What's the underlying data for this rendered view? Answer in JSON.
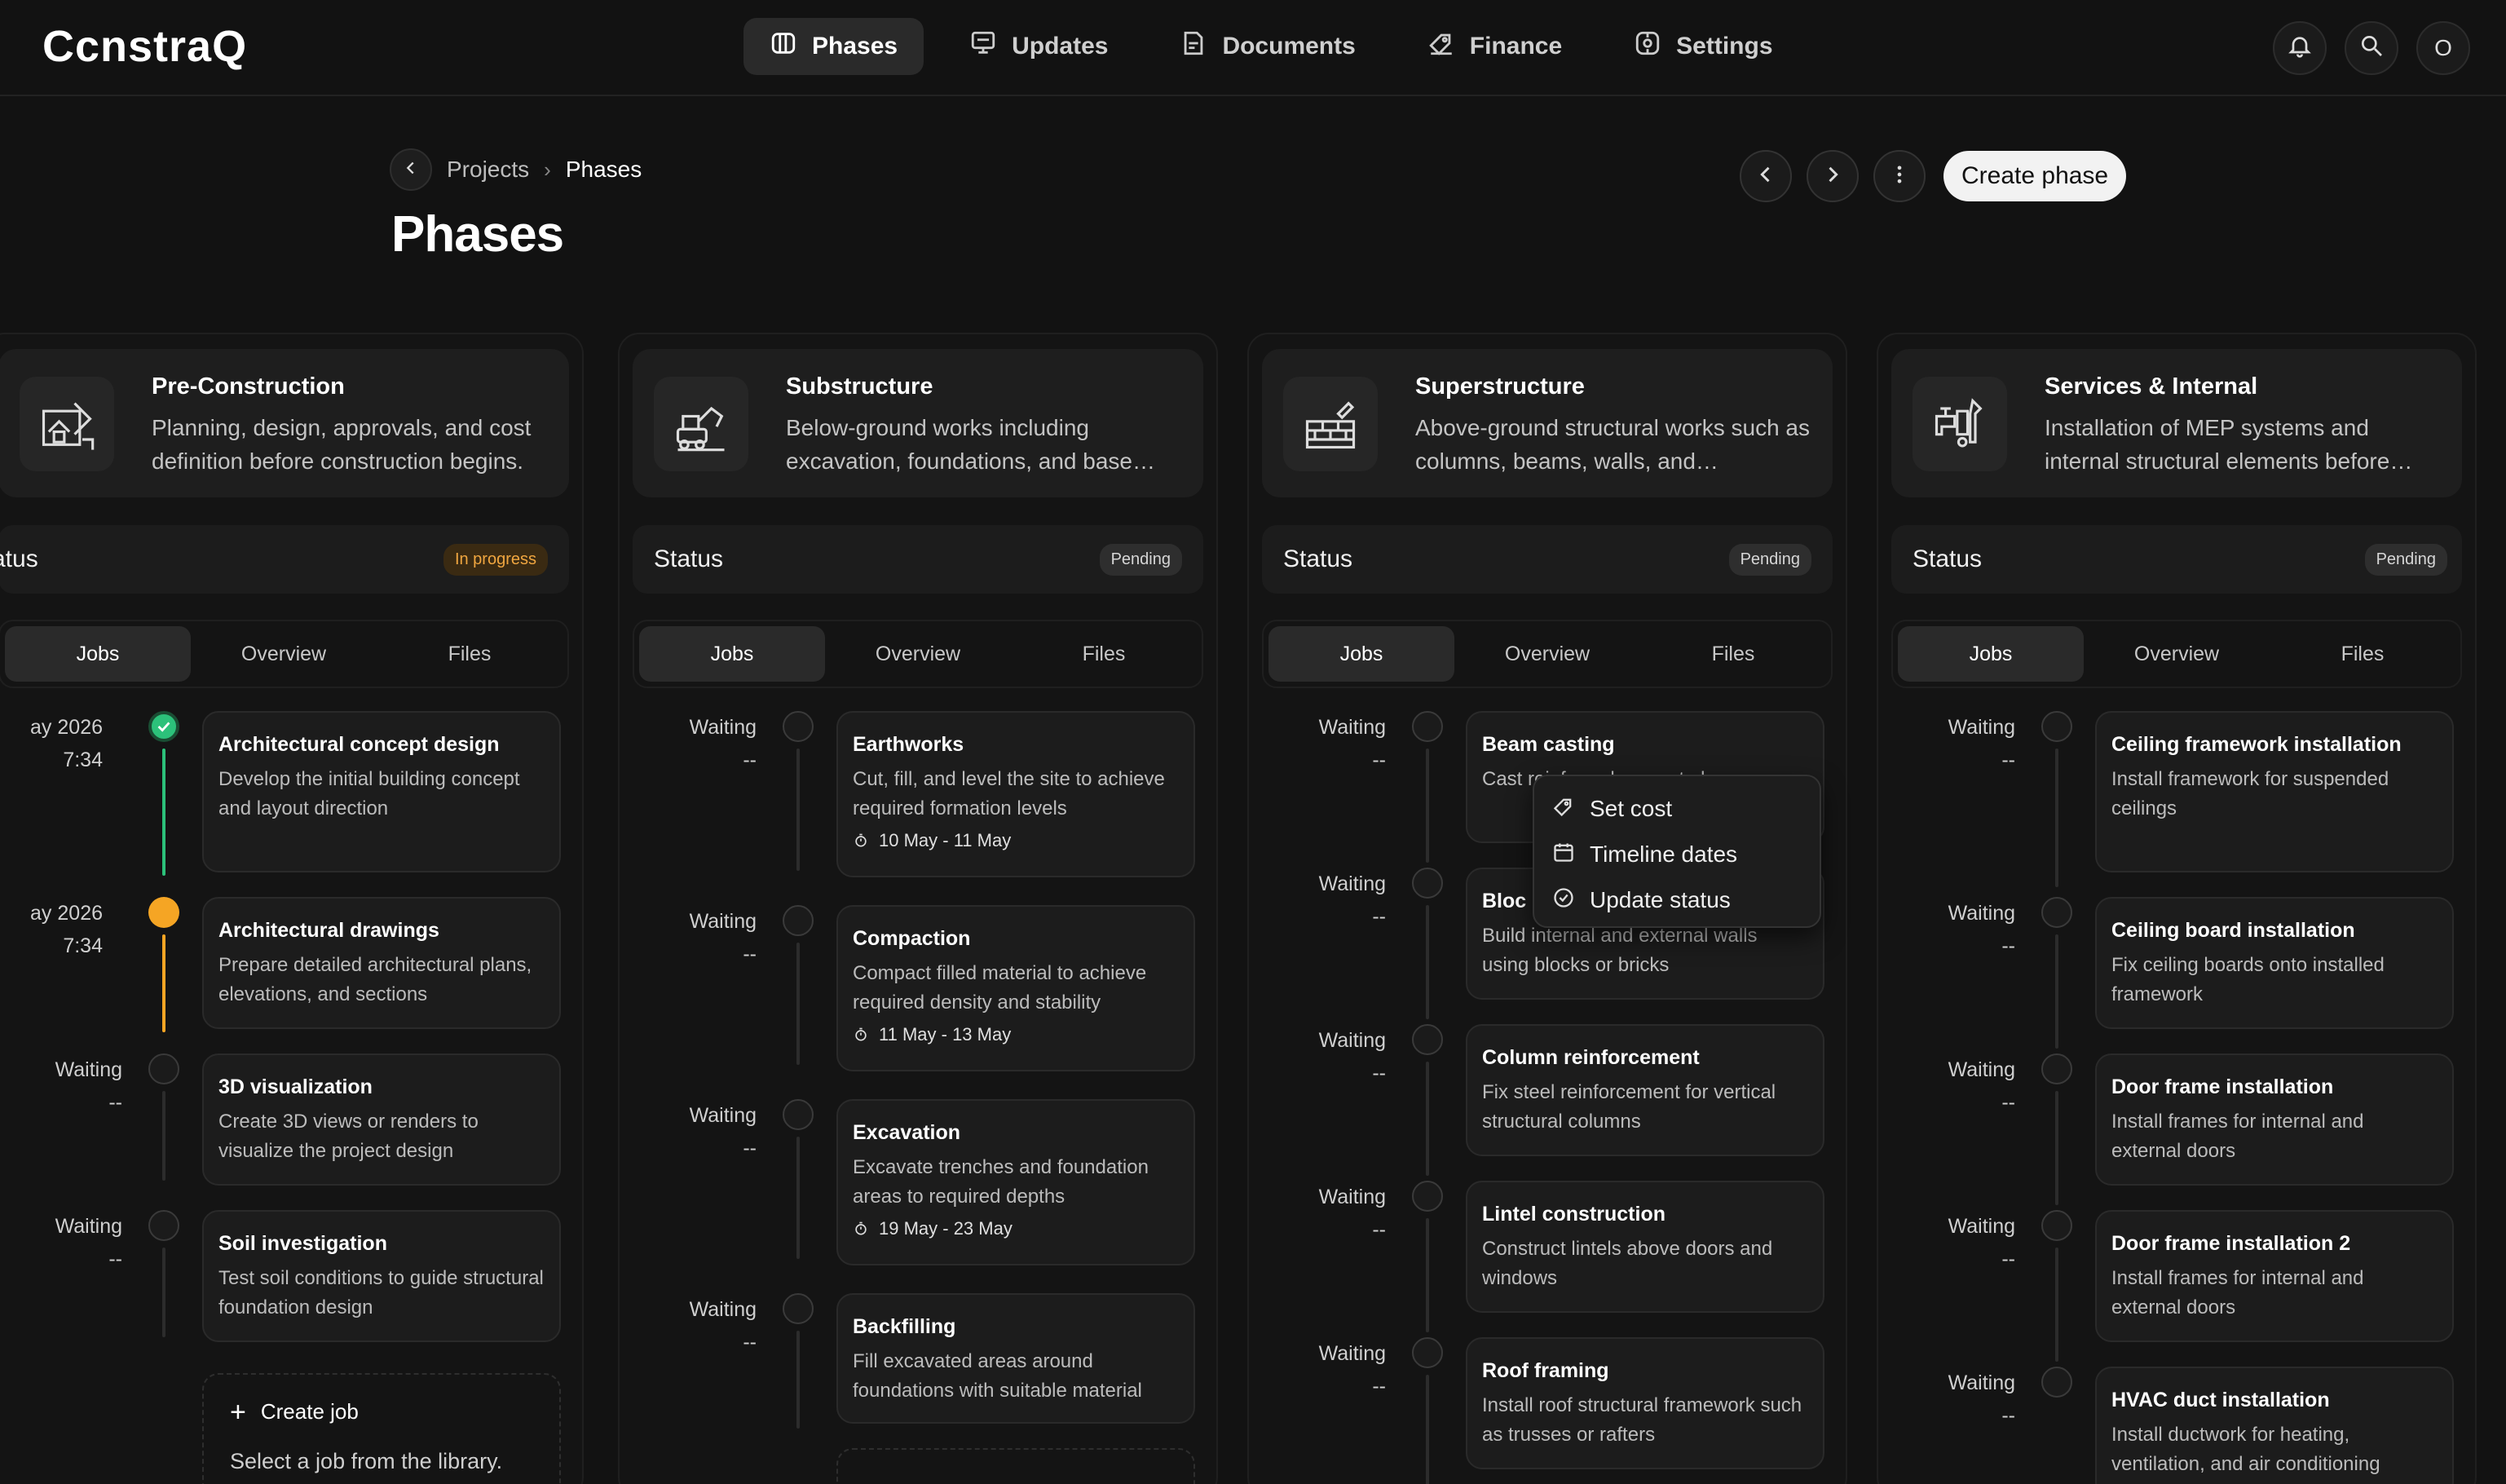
{
  "app": {
    "logo": "CcnstraQ"
  },
  "nav": {
    "tabs": [
      {
        "label": "Phases",
        "icon": "phases-icon",
        "active": true
      },
      {
        "label": "Updates",
        "icon": "updates-icon",
        "active": false
      },
      {
        "label": "Documents",
        "icon": "documents-icon",
        "active": false
      },
      {
        "label": "Finance",
        "icon": "finance-icon",
        "active": false
      },
      {
        "label": "Settings",
        "icon": "settings-icon",
        "active": false
      }
    ],
    "avatar_initial": "O"
  },
  "breadcrumb": {
    "parent": "Projects",
    "current": "Phases"
  },
  "page": {
    "title": "Phases",
    "create_button": "Create phase"
  },
  "status_label": "Status",
  "tabs": [
    "Jobs",
    "Overview",
    "Files"
  ],
  "columns": [
    {
      "title": "Pre-Construction",
      "description": "Planning, design, approvals, and cost definition before construction begins.",
      "status_label": "atus",
      "status": "In progress",
      "jobs": [
        {
          "time_top": "ay 2026",
          "time_bottom": "7:34",
          "title": "Architectural concept design",
          "description": "Develop the initial building concept and layout direction",
          "dates": ""
        },
        {
          "time_top": "ay 2026",
          "time_bottom": "7:34",
          "title": "Architectural drawings",
          "description": "Prepare detailed architectural plans, elevations, and sections",
          "dates": ""
        },
        {
          "time_top": "Waiting",
          "time_bottom": "--",
          "title": "3D visualization",
          "description": "Create 3D views or renders to visualize the project design",
          "dates": ""
        },
        {
          "time_top": "Waiting",
          "time_bottom": "--",
          "title": "Soil investigation",
          "description": "Test soil conditions to guide structural foundation design",
          "dates": ""
        }
      ],
      "create_job": {
        "title": "Create job",
        "subtitle": "Select a job from the library."
      }
    },
    {
      "title": "Substructure",
      "description": "Below-ground works including excavation, foundations, and base…",
      "status_label": "Status",
      "status": "Pending",
      "jobs": [
        {
          "time_top": "Waiting",
          "time_bottom": "--",
          "title": "Earthworks",
          "description": "Cut, fill, and level the site to achieve required formation levels",
          "dates": "10 May - 11 May"
        },
        {
          "time_top": "Waiting",
          "time_bottom": "--",
          "title": "Compaction",
          "description": "Compact filled material to achieve required density and stability",
          "dates": "11 May - 13 May"
        },
        {
          "time_top": "Waiting",
          "time_bottom": "--",
          "title": "Excavation",
          "description": "Excavate trenches and foundation areas to required depths",
          "dates": "19 May - 23 May"
        },
        {
          "time_top": "Waiting",
          "time_bottom": "--",
          "title": "Backfilling",
          "description": "Fill excavated areas around foundations with suitable material",
          "dates": ""
        }
      ]
    },
    {
      "title": "Superstructure",
      "description": "Above-ground structural works such as columns, beams, walls, and…",
      "status_label": "Status",
      "status": "Pending",
      "jobs": [
        {
          "time_top": "Waiting",
          "time_bottom": "--",
          "title": "Beam casting",
          "description": "Cast reinforced concrete beams",
          "dates": ""
        },
        {
          "time_top": "Waiting",
          "time_bottom": "--",
          "title": "Bloc",
          "description": "Build internal and external walls using blocks or bricks",
          "dates": ""
        },
        {
          "time_top": "Waiting",
          "time_bottom": "--",
          "title": "Column reinforcement",
          "description": "Fix steel reinforcement for vertical structural columns",
          "dates": ""
        },
        {
          "time_top": "Waiting",
          "time_bottom": "--",
          "title": "Lintel construction",
          "description": "Construct lintels above doors and windows",
          "dates": ""
        },
        {
          "time_top": "Waiting",
          "time_bottom": "--",
          "title": "Roof framing",
          "description": "Install roof structural framework such as trusses or rafters",
          "dates": ""
        }
      ]
    },
    {
      "title": "Services & Internal",
      "description": "Installation of MEP systems and internal structural elements before…",
      "status_label": "Status",
      "status": "Pending",
      "jobs": [
        {
          "time_top": "Waiting",
          "time_bottom": "--",
          "title": "Ceiling framework installation",
          "description": "Install framework for suspended ceilings",
          "dates": ""
        },
        {
          "time_top": "Waiting",
          "time_bottom": "--",
          "title": "Ceiling board installation",
          "description": "Fix ceiling boards onto installed framework",
          "dates": ""
        },
        {
          "time_top": "Waiting",
          "time_bottom": "--",
          "title": "Door frame installation",
          "description": "Install frames for internal and external doors",
          "dates": ""
        },
        {
          "time_top": "Waiting",
          "time_bottom": "--",
          "title": "Door frame installation 2",
          "description": "Install frames for internal and external doors",
          "dates": ""
        },
        {
          "time_top": "Waiting",
          "time_bottom": "--",
          "title": "HVAC duct installation",
          "description": "Install ductwork for heating, ventilation, and air conditioning",
          "dates": ""
        }
      ]
    }
  ],
  "context_menu": {
    "items": [
      {
        "label": "Set cost",
        "icon": "tag-icon"
      },
      {
        "label": "Timeline dates",
        "icon": "calendar-icon"
      },
      {
        "label": "Update status",
        "icon": "check-circle-icon"
      }
    ]
  },
  "colors": {
    "background": "#121212",
    "done": "#2cc17a",
    "in_progress": "#f5a524"
  }
}
